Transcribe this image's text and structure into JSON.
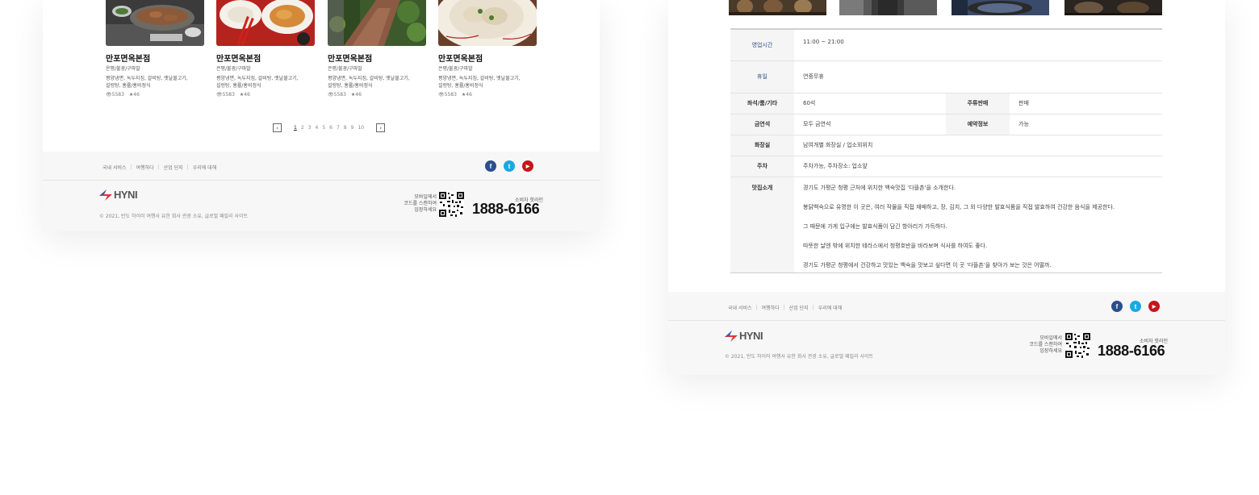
{
  "left_page": {
    "cards": [
      {
        "title": "만포면옥본점",
        "category": "온평/불광/구파발",
        "desc1": "평양냉면, 녹두지짐, 갈비탕, 옛날불고기,",
        "desc2": "설렁탕, 홍률/홍비정식",
        "views": "5583",
        "likes": "46"
      },
      {
        "title": "만포면옥본점",
        "category": "은평/불광/구파발",
        "desc1": "평양냉면, 녹두지짐, 갈비탕, 옛날불고기,",
        "desc2": "설렁탕, 홍률/홍비정식",
        "views": "5583",
        "likes": "46"
      },
      {
        "title": "만포면옥본점",
        "category": "은평/불광/구파발",
        "desc1": "평양냉면, 녹두지짐, 갈비탕, 옛날불고기,",
        "desc2": "설렁탕, 홍률/홍비정식",
        "views": "5583",
        "likes": "46"
      },
      {
        "title": "만포면옥본점",
        "category": "은평/불광/구파발",
        "desc1": "평양냉면, 녹두지짐, 갈비탕, 옛날불고기,",
        "desc2": "설렁탕, 홍률/홍비정식",
        "views": "5583",
        "likes": "46"
      }
    ],
    "pagination": {
      "prev": "‹",
      "next": "›",
      "pages": [
        "1",
        "2",
        "3",
        "4",
        "5",
        "6",
        "7",
        "8",
        "9",
        "10"
      ],
      "active": "1"
    }
  },
  "right_page": {
    "info_rows": {
      "hours_label": "영업시간",
      "hours_value": "11:00 ~ 21:00",
      "closed_label": "휴일",
      "closed_value": "연중무휴",
      "seats_label": "좌석/룸/기타",
      "seats_value": "60석",
      "liquor_label": "주류판매",
      "liquor_value": "판매",
      "smoking_label": "금연석",
      "smoking_value": "모두 금연석",
      "reserve_label": "예약정보",
      "reserve_value": "가능",
      "restroom_label": "화장실",
      "restroom_value": "남여개별 화장실 / 업소외위치",
      "parking_label": "주차",
      "parking_value": "주차가능, 주차장소: 업소앞",
      "intro_label": "맛집소개",
      "intro_lines": [
        "경기도 가평군 청평 근처에 위치한 백숙맛집 '다뜰촌'을 소개한다.",
        "봉닭백숙으로 유명한 이 곳은, 여러 작물을 직접 재배하고, 장, 김치, 그 외 다양한 발효식품을 직접 발효하여 건강한 음식을 제공한다.",
        "그 때문에 가게 입구에는 발효식품이 담긴 항아리가 가득하다.",
        "따뜻한 날엔 밖에 위치한 테라스에서 청평호반을 바라보며 식사를 하여도 좋다.",
        "경기도 가평군 청평에서 건강하고 맛있는 백숙을 맛보고 싶다면 이 곳 '다뜰촌'을 찾아가 보는 것은 어떨까."
      ]
    }
  },
  "footer": {
    "links": [
      "국내 서비스",
      "여행하다",
      "산업 단지",
      "우리에 대해"
    ],
    "social": {
      "facebook": "f",
      "twitter": "t",
      "youtube": "▶"
    },
    "logo": "HYNI",
    "copyright": "© 2021, 반도 하이러 여행사 유한 회사 관광 소유, 글로벌 패밀리 사이트",
    "qr_text": [
      "모바일에서",
      "코드를 스캔하여",
      "입장하세요"
    ],
    "call_label": "소비자 핫라인",
    "call_number": "1888-6166"
  },
  "colors": {
    "facebook": "#2b4e8c",
    "twitter": "#19a9e1",
    "youtube": "#c4161c",
    "label_blue": "#35508a",
    "logo_red": "#e4323c",
    "logo_blue": "#3a5aa8"
  }
}
